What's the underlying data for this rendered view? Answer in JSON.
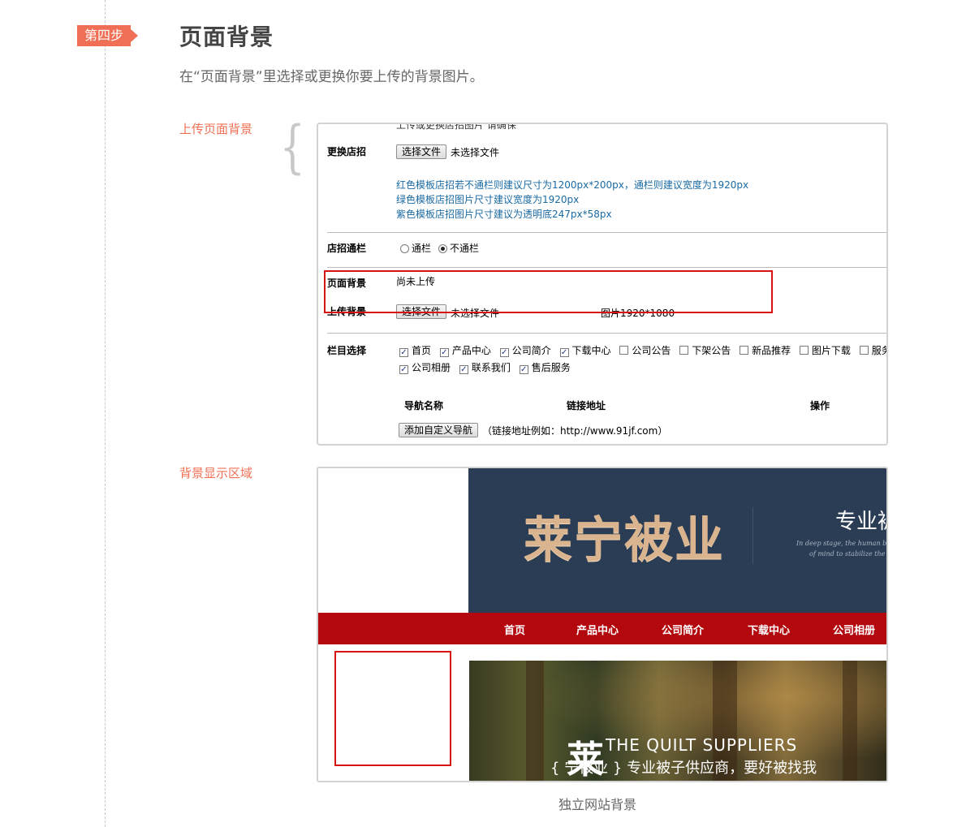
{
  "step": {
    "badge": "第四步",
    "title": "页面背景",
    "desc": "在“页面背景”里选择或更换你要上传的背景图片。"
  },
  "labels": {
    "upload": "上传页面背景",
    "display": "背景显示区域",
    "caption": "独立网站背景"
  },
  "form": {
    "clipped_top": "上传或更换店招图片 请确保",
    "sign_label": "更换店招",
    "file_button": "选择文件",
    "no_file": "未选择文件",
    "hints": [
      "红色模板店招若不通栏则建议尺寸为1200px*200px，通栏则建议宽度为1920px",
      "绿色模板店招图片尺寸建议宽度为1920px",
      "紫色模板店招图片尺寸建议为透明底247px*58px"
    ],
    "banner_label": "店招通栏",
    "radio_full": "通栏",
    "radio_notfull": "不通栏",
    "bg_label": "页面背景",
    "bg_status": "尚未上传",
    "upload_bg_label": "上传背景",
    "bg_size": "图片1920*1080",
    "column_label": "栏目选择",
    "columns_row1": [
      {
        "name": "首页",
        "checked": true
      },
      {
        "name": "产品中心",
        "checked": true
      },
      {
        "name": "公司简介",
        "checked": true
      },
      {
        "name": "下载中心",
        "checked": true
      },
      {
        "name": "公司公告",
        "checked": false
      },
      {
        "name": "下架公告",
        "checked": false
      },
      {
        "name": "新品推荐",
        "checked": false
      },
      {
        "name": "图片下载",
        "checked": false
      },
      {
        "name": "服务",
        "checked": false
      }
    ],
    "columns_row2": [
      {
        "name": "公司相册",
        "checked": true
      },
      {
        "name": "联系我们",
        "checked": true
      },
      {
        "name": "售后服务",
        "checked": true
      }
    ],
    "nav_name_head": "导航名称",
    "link_head": "链接地址",
    "op_head": "操作",
    "add_nav_button": "添加自定义导航",
    "link_example": "（链接地址例如：http://www.91jf.com）"
  },
  "preview": {
    "brand": "莱宁被业",
    "slogan": "专业被",
    "slogan_en_1": "In deep stage, the human brain",
    "slogan_en_2": "of mind to stabilize the mood",
    "nav": [
      "首页",
      "产品中心",
      "公司简介",
      "下载中心",
      "公司相册"
    ],
    "hero_en": "THE QUILT SUPPLIERS",
    "hero_big": "莱",
    "hero_cn": "{ 宁被业 } 专业被子供应商，要好被找我"
  },
  "colors": {
    "accent": "#f07055",
    "highlight_red": "#d71414",
    "nav_red": "#b3090e",
    "banner_navy": "#2b3d55",
    "hint_blue": "#1a6aa3"
  }
}
